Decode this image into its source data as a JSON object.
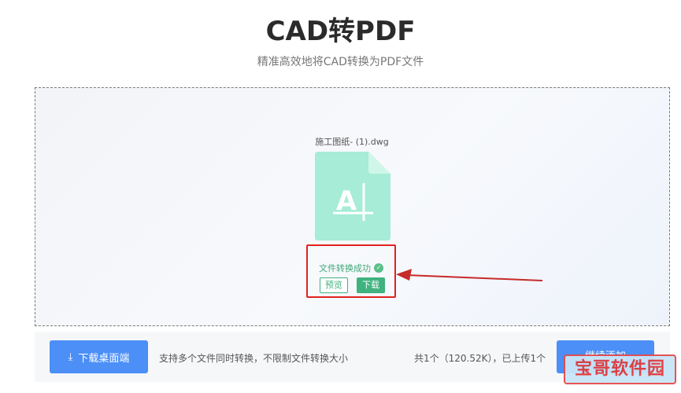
{
  "header": {
    "title": "CAD转PDF",
    "subtitle": "精准高效地将CAD转换为PDF文件"
  },
  "file": {
    "name": "施工图纸- (1).dwg",
    "icon": "dwg-file-icon",
    "icon_letter": "A",
    "status_text": "文件转换成功",
    "preview_label": "预览",
    "download_label": "下载"
  },
  "toolbar": {
    "desktop_download_label": "下载桌面端",
    "support_text": "支持多个文件同时转换，不限制文件转换大小",
    "count_text": "共1个（120.52K），已上传1个",
    "continue_label": "继续添加"
  },
  "watermark": {
    "text": "宝哥软件园"
  },
  "colors": {
    "accent_blue": "#4b8ff7",
    "success_green": "#3fb27f",
    "file_icon_teal": "#a6ecd6",
    "highlight_red": "#e0231e"
  }
}
